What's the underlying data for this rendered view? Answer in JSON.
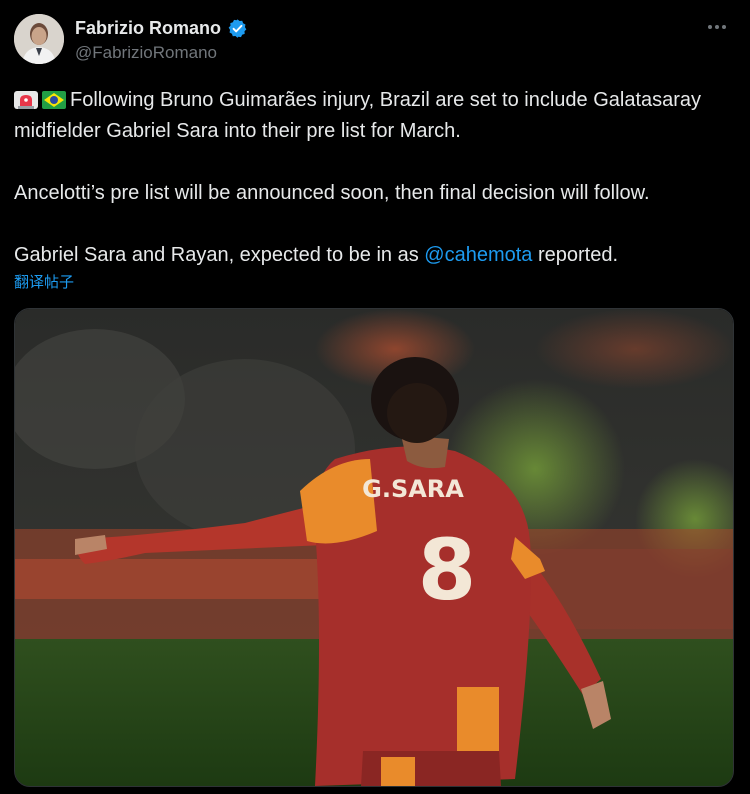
{
  "author": {
    "display_name": "Fabrizio Romano",
    "handle": "@FabrizioRomano",
    "verified": true
  },
  "tweet": {
    "line1_prefix_emojis": [
      "rotating-light-icon",
      "brazil-flag-icon"
    ],
    "paragraph1": "Following Bruno Guimarães injury, Brazil are set to include Galatasaray midfielder Gabriel Sara into their pre list for March.",
    "paragraph2": "Ancelotti’s pre list will be announced soon, then final decision will follow.",
    "paragraph3_before": "Gabriel Sara and Rayan, expected to be in as ",
    "paragraph3_mention": "@cahemota",
    "paragraph3_after": " reported."
  },
  "translate_label": "翻译帖子",
  "media": {
    "jersey_name": "G.SARA",
    "jersey_number": "8"
  },
  "colors": {
    "accent": "#1d9bf0",
    "background": "#000000",
    "text": "#e7e9ea",
    "secondary": "#71767b"
  }
}
